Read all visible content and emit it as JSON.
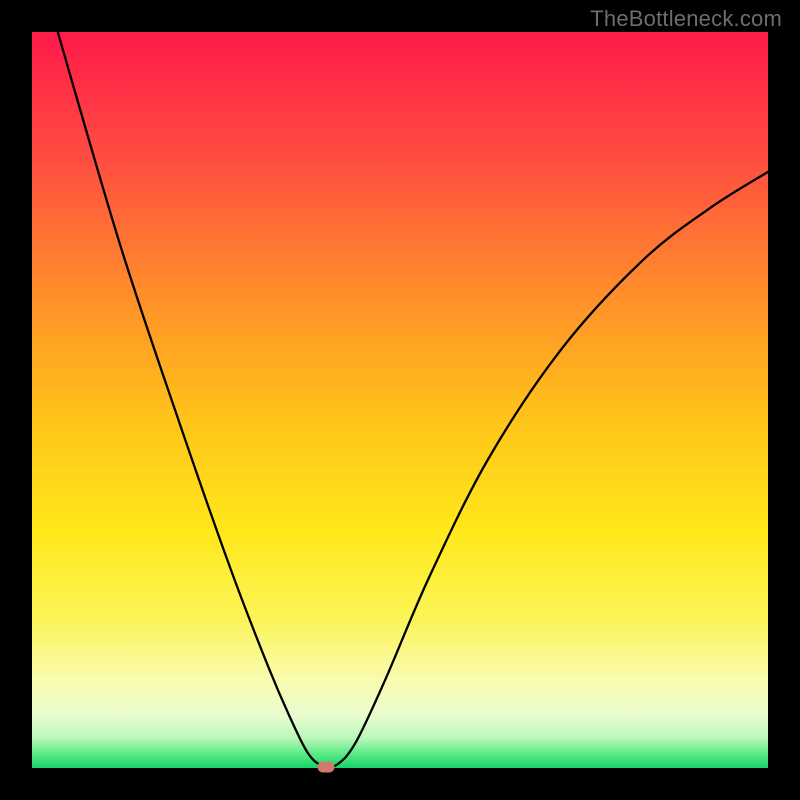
{
  "watermark": "TheBottleneck.com",
  "chart_data": {
    "type": "line",
    "title": "",
    "xlabel": "",
    "ylabel": "",
    "xlim": [
      0,
      1
    ],
    "ylim": [
      0,
      1
    ],
    "series": [
      {
        "name": "bottleneck-curve",
        "points": [
          {
            "x": 0.035,
            "y": 1.0
          },
          {
            "x": 0.12,
            "y": 0.71
          },
          {
            "x": 0.2,
            "y": 0.47
          },
          {
            "x": 0.27,
            "y": 0.27
          },
          {
            "x": 0.32,
            "y": 0.14
          },
          {
            "x": 0.35,
            "y": 0.07
          },
          {
            "x": 0.375,
            "y": 0.02
          },
          {
            "x": 0.395,
            "y": 0.003
          },
          {
            "x": 0.415,
            "y": 0.005
          },
          {
            "x": 0.44,
            "y": 0.035
          },
          {
            "x": 0.48,
            "y": 0.12
          },
          {
            "x": 0.54,
            "y": 0.26
          },
          {
            "x": 0.62,
            "y": 0.42
          },
          {
            "x": 0.72,
            "y": 0.57
          },
          {
            "x": 0.83,
            "y": 0.69
          },
          {
            "x": 0.92,
            "y": 0.76
          },
          {
            "x": 1.0,
            "y": 0.81
          }
        ]
      }
    ],
    "marker": {
      "x": 0.4,
      "y": 0.002,
      "color": "#cf7a6c"
    }
  },
  "colors": {
    "frame": "#000000",
    "curve": "#000000",
    "marker": "#cf7a6c",
    "watermark": "#6d6d6d"
  }
}
